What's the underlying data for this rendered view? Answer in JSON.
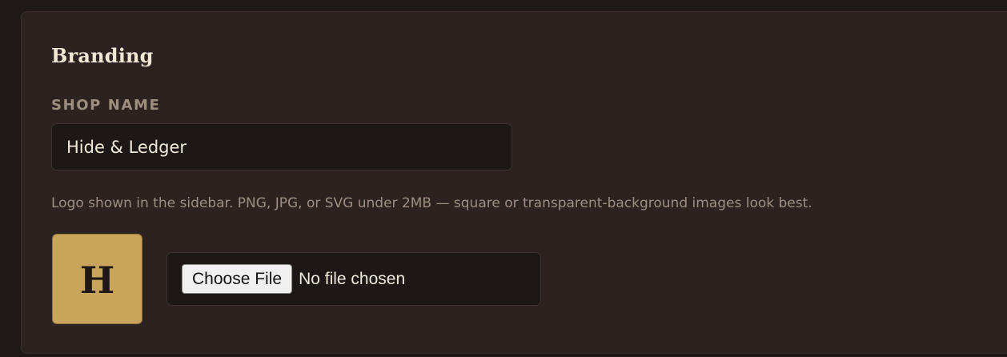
{
  "branding": {
    "title": "Branding",
    "shop_name": {
      "label": "SHOP NAME",
      "value": "Hide & Ledger"
    },
    "logo": {
      "help_text": "Logo shown in the sidebar. PNG, JPG, or SVG under 2MB — square or transparent-background images look best.",
      "preview_letter": "H",
      "preview_color": "#c9a55b",
      "file_input": {
        "button_label": "Choose File",
        "status": "No file chosen"
      }
    }
  },
  "colors": {
    "background": "#1e1917",
    "card": "#2c2320",
    "accent": "#c9a55b"
  }
}
